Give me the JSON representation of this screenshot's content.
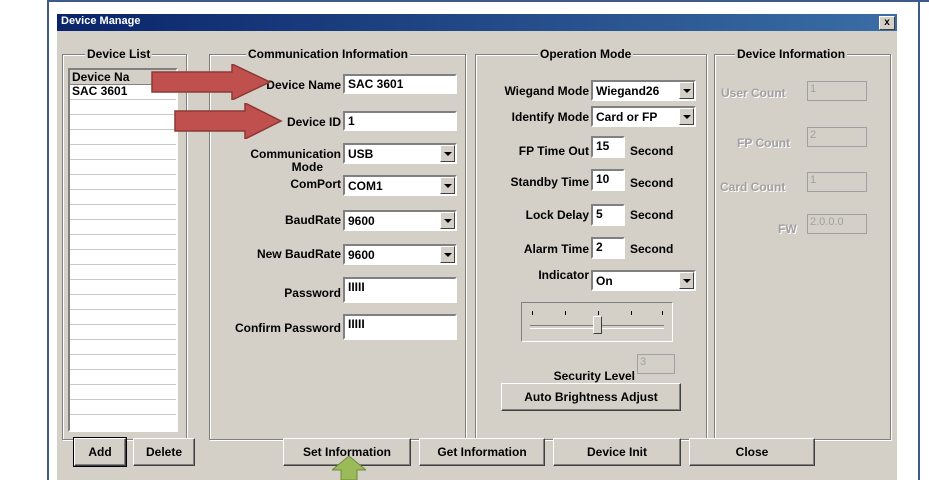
{
  "window": {
    "title": "Device Manage",
    "close_glyph": "x"
  },
  "device_list": {
    "legend": "Device List",
    "column_header": "Device Na",
    "items": [
      "SAC 3601"
    ]
  },
  "communication": {
    "legend": "Communication Information",
    "device_name_label": "Device Name",
    "device_name_value": "SAC 3601",
    "device_id_label": "Device ID",
    "device_id_value": "1",
    "comm_mode_label_1": "Communication",
    "comm_mode_label_2": "Mode",
    "comm_mode_value": "USB",
    "comport_label": "ComPort",
    "comport_value": "COM1",
    "baudrate_label": "BaudRate",
    "baudrate_value": "9600",
    "new_baudrate_label": "New BaudRate",
    "new_baudrate_value": "9600",
    "password_label": "Password",
    "password_value": "IIIII",
    "confirm_password_label": "Confirm Password",
    "confirm_password_value": "IIIII"
  },
  "operation": {
    "legend": "Operation Mode",
    "wiegand_label": "Wiegand Mode",
    "wiegand_value": "Wiegand26",
    "identify_label": "Identify Mode",
    "identify_value": "Card or FP",
    "fp_timeout_label": "FP Time Out",
    "fp_timeout_value": "15",
    "standby_label": "Standby Time",
    "standby_value": "10",
    "lock_delay_label": "Lock Delay",
    "lock_delay_value": "5",
    "alarm_label": "Alarm Time",
    "alarm_value": "2",
    "unit": "Second",
    "indicator_label": "Indicator",
    "indicator_value": "On",
    "security_label": "Security Level",
    "security_value": "3",
    "auto_brightness_label": "Auto Brightness Adjust"
  },
  "device_info": {
    "legend": "Device Information",
    "user_count_label": "User Count",
    "user_count_value": "1",
    "fp_count_label": "FP Count",
    "fp_count_value": "2",
    "card_count_label": "Card Count",
    "card_count_value": "1",
    "fw_label": "FW",
    "fw_value": "2.0.0.0"
  },
  "buttons": {
    "add": "Add",
    "delete": "Delete",
    "set_info": "Set Information",
    "get_info": "Get Information",
    "device_init": "Device Init",
    "close": "Close"
  },
  "colors": {
    "arrow_red": "#c0504d",
    "arrow_green": "#9bbb59",
    "titlebar": "#0a246a"
  }
}
